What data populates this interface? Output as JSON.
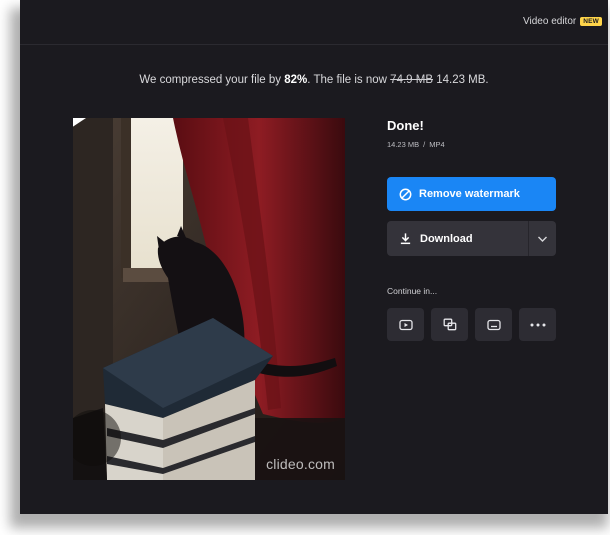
{
  "header": {
    "editor_label": "Video editor",
    "new_badge": "NEW"
  },
  "summary": {
    "prefix": "We compressed your file by",
    "percent": "82%",
    "middle": ". The file is now",
    "old_size": "74.9 MB",
    "new_size": "14.23 MB."
  },
  "video": {
    "watermark": "clideo.com"
  },
  "result": {
    "title": "Done!",
    "size": "14.23 MB",
    "separator": "/",
    "format": "MP4"
  },
  "actions": {
    "remove_watermark": "Remove watermark",
    "download": "Download"
  },
  "continue": {
    "label": "Continue in...",
    "tools": [
      {
        "icon": "video-player-icon"
      },
      {
        "icon": "layers-icon"
      },
      {
        "icon": "subtitles-icon"
      },
      {
        "icon": "more-dots-icon"
      }
    ]
  },
  "colors": {
    "background": "#1b1a1f",
    "accent": "#1a86f5",
    "secondary_button": "#34333a",
    "new_badge": "#ffd54a"
  }
}
